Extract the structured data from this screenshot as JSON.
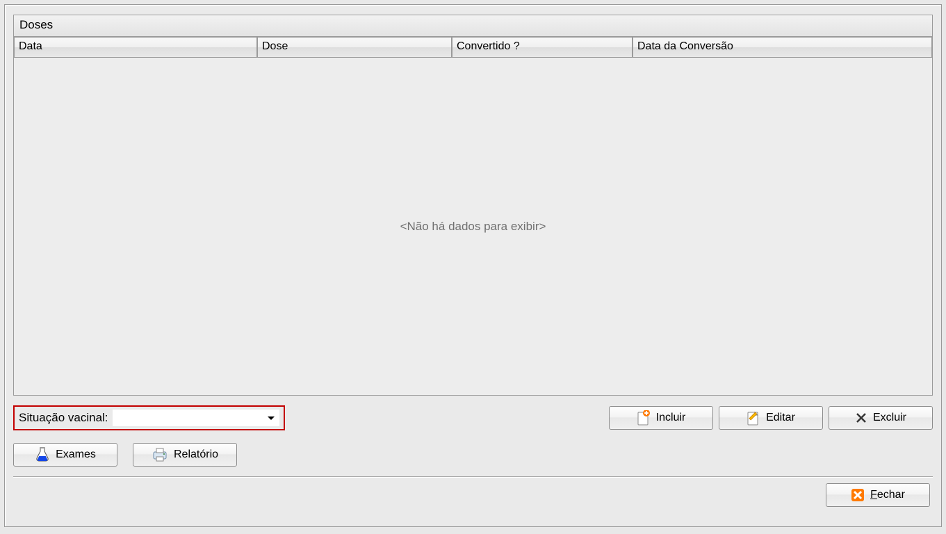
{
  "group_title": "Doses",
  "columns": {
    "data": "Data",
    "dose": "Dose",
    "convertido": "Convertido ?",
    "data_conversao": "Data da Conversão"
  },
  "empty_text": "<Não há dados para exibir>",
  "situacao_label": "Situação vacinal:",
  "combo_value": "",
  "buttons": {
    "incluir": "Incluir",
    "editar": "Editar",
    "excluir": "Excluir",
    "exames": "Exames",
    "relatorio": "Relatório",
    "fechar": "Fechar"
  }
}
